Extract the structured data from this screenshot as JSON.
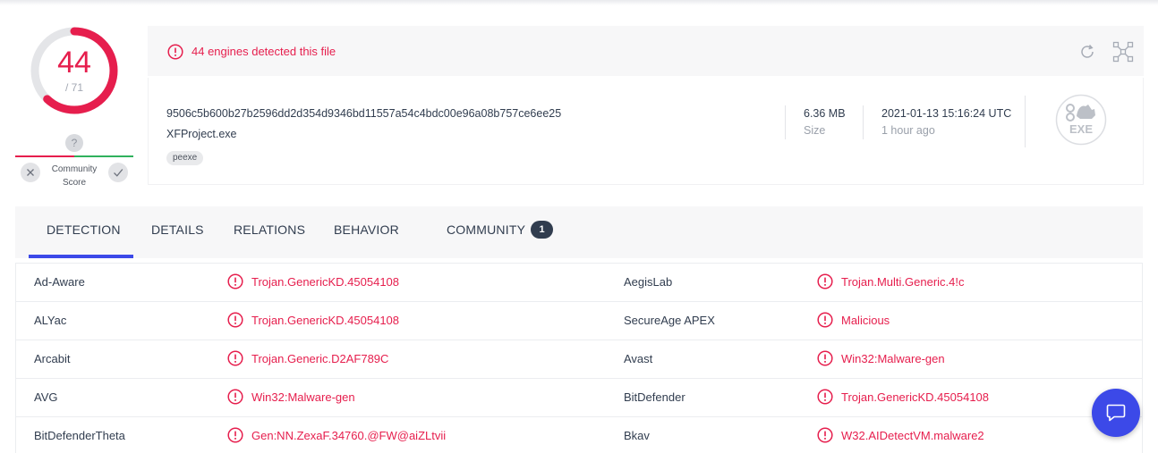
{
  "score": {
    "detected": "44",
    "total": "/ 71",
    "fraction": 0.62,
    "color": "#e61e4d"
  },
  "community": {
    "question_glyph": "?",
    "label": "Community\nScore",
    "downvote_icon": "close-icon",
    "upvote_icon": "check-icon"
  },
  "detection_banner": {
    "message": "44 engines detected this file",
    "icons": [
      "alert-circle-icon",
      "reload-icon",
      "graph-summary-icon"
    ]
  },
  "file": {
    "hash": "9506c5b600b27b2596dd2d354d9346bd11557a54c4bdc00e96a08b757ce6ee25",
    "name": "XFProject.exe",
    "tag": "peexe",
    "size_value": "6.36 MB",
    "size_label": "Size",
    "date_value": "2021-01-13 15:16:24 UTC",
    "date_relative": "1 hour ago",
    "type_icon": "exe-file-icon",
    "type_label": "EXE"
  },
  "tabs": [
    {
      "label": "DETECTION",
      "active": true
    },
    {
      "label": "DETAILS"
    },
    {
      "label": "RELATIONS"
    },
    {
      "label": "BEHAVIOR"
    },
    {
      "label": "COMMUNITY",
      "badge": "1"
    }
  ],
  "engines": [
    {
      "left": {
        "engine": "Ad-Aware",
        "result": "Trojan.GenericKD.45054108"
      },
      "right": {
        "engine": "AegisLab",
        "result": "Trojan.Multi.Generic.4!c"
      }
    },
    {
      "left": {
        "engine": "ALYac",
        "result": "Trojan.GenericKD.45054108"
      },
      "right": {
        "engine": "SecureAge APEX",
        "result": "Malicious"
      }
    },
    {
      "left": {
        "engine": "Arcabit",
        "result": "Trojan.Generic.D2AF789C"
      },
      "right": {
        "engine": "Avast",
        "result": "Win32:Malware-gen"
      }
    },
    {
      "left": {
        "engine": "AVG",
        "result": "Win32:Malware-gen"
      },
      "right": {
        "engine": "BitDefender",
        "result": "Trojan.GenericKD.45054108"
      }
    },
    {
      "left": {
        "engine": "BitDefenderTheta",
        "result": "Gen:NN.ZexaF.34760.@FW@aiZLtvii"
      },
      "right": {
        "engine": "Bkav",
        "result": "W32.AIDetectVM.malware2"
      }
    }
  ],
  "colors": {
    "accent": "#3c49e8",
    "danger": "#e61e4d",
    "positive": "#30b15d",
    "text": "#313d4f"
  }
}
